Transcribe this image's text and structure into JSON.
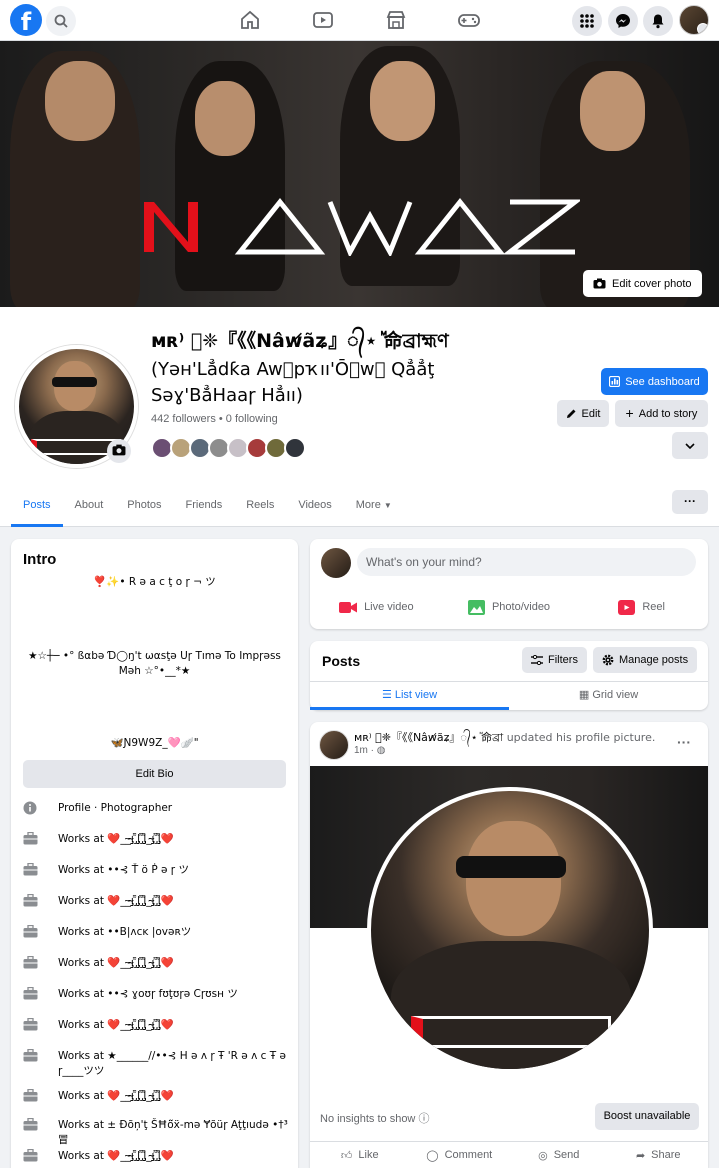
{
  "nav": {
    "logo_letter": "f",
    "icons": [
      "search-icon",
      "home-icon",
      "video-icon",
      "marketplace-icon",
      "gaming-icon",
      "menu-grid-icon",
      "messenger-icon",
      "bell-icon"
    ]
  },
  "cover": {
    "edit_label": "Edit cover photo",
    "watermark": "NAWAZ"
  },
  "profile": {
    "name": "ᴍʀ⁾ ⃟❈『《《Nâw̸ãʑ』᭄⋆ ⷨ命ব্রাহ্মণ",
    "subtitle": "(Yəʜ'Lẳdƙa Awᷠpҡıı'Ōᷠwᷠ Qẳẳţ Səɣ'BẳHaaɼ Hẳıı)",
    "followers": "442 followers",
    "following": "0 following",
    "dashboard_label": "See dashboard",
    "edit_label": "Edit",
    "story_label": "Add to story",
    "friend_colors": [
      "#6b4f73",
      "#b9a27a",
      "#5b6a7a",
      "#8d8d8d",
      "#c7c0c7",
      "#a63b3b",
      "#6f6a3a",
      "#30343b"
    ]
  },
  "tabs": [
    "Posts",
    "About",
    "Photos",
    "Friends",
    "Reels",
    "Videos",
    "More"
  ],
  "intro": {
    "title": "Intro",
    "bio": [
      "❣️✨• R ə a c ţ o ɼ ¬ ツ",
      "★☆┼─ •° ßαbə Ɗ◯ŋ't ωαsţə Uɼ Tımə To Impɼəss Məh ☆°•__*★",
      "🦋Ɲ9W9Z_🩷🪽\""
    ],
    "edit_bio": "Edit Bio",
    "details": [
      "Profile · Photographer",
      "Works at ❤️__̴ı̴̴̡̡̡ ̡͌l̡̡̡ ̡͌l̡̡̡̡͌_ı̴̴̡̡̡ ̡͌l̡̡̡̡͌❤️",
      "Works at ••⊰ Ť ö Ṗ ə ɼ ツ",
      "Works at ❤️__̴ı̴̴̡̡̡ ̡͌l̡̡̡ ̡͌l̡̡̡̡͌_ı̴̴̡̡̡ ̡͌l̡̡̡̡͌❤️",
      "Works at ••B|ʌcĸ |ovəʀツ",
      "Works at ❤️__̴ı̴̴̡̡̡ ̡͌l̡̡̡ ̡͌l̡̡̡̡͌_ı̴̴̡̡̡ ̡͌l̡̡̡̡͌❤️",
      "Works at ••⊰ ɣoʊɼ fʊţʊɼə Cɼʊsʜ ツ",
      "Works at ❤️__̴ı̴̴̡̡̡ ̡͌l̡̡̡ ̡͌l̡̡̡̡͌_ı̴̴̡̡̡ ̡͌l̡̡̡̡͌❤️",
      "Works at ★______//••⊰ H ə ʌ ɼ Ŧ 'R ə ʌ c Ŧ ə ɼ____ツツ",
      "Works at ❤️__̴ı̴̴̡̡̡ ̡͌l̡̡̡ ̡͌l̡̡̡̡͌_ı̴̴̡̡̡ ̡͌l̡̡̡̡͌❤️",
      "Works at ± Ɖõņ'ţ ŠĦö̃ẍ-mə Ɏõüɼ Aţţıudə •†³冒",
      "Works at ❤️__̴ı̴̴̡̡̡ ̡͌l̡̡̡ ̡͌l̡̡̡̡͌_ı̴̴̡̡̡ ̡͌l̡̡̡̡͌❤️"
    ]
  },
  "composer": {
    "placeholder": "What's on your mind?",
    "live": "Live video",
    "photo": "Photo/video",
    "reel": "Reel"
  },
  "posts": {
    "title": "Posts",
    "filters": "Filters",
    "manage": "Manage posts",
    "list_view": "List view",
    "grid_view": "Grid view"
  },
  "post": {
    "author": "ᴍʀ⁾ ⃟❈『《《Nâw̸ãʑ』᭄⋆ ⷨ命ব্রা",
    "action": "updated his profile picture.",
    "time": "1m",
    "insights": "No insights to show",
    "boost": "Boost unavailable",
    "like": "Like",
    "comment": "Comment",
    "send": "Send",
    "share": "Share"
  }
}
